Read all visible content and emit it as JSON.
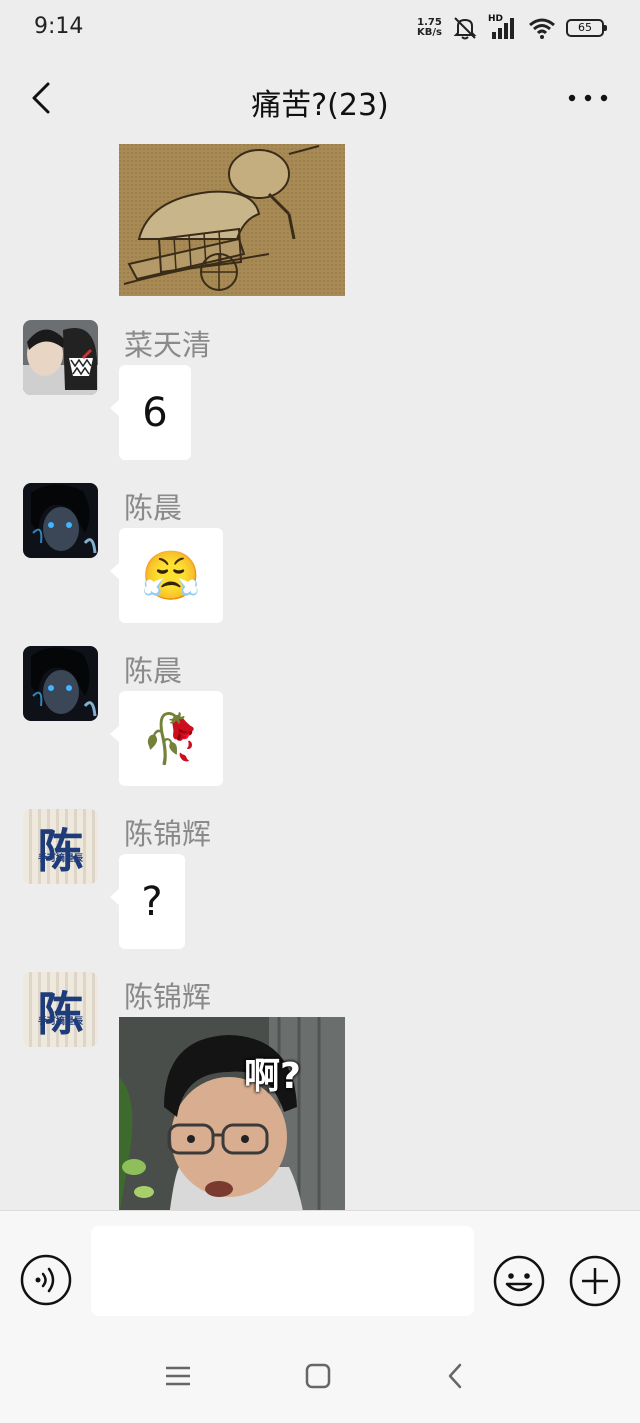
{
  "status_bar": {
    "time": "9:14",
    "net_speed_value": "1.75",
    "net_speed_unit": "KB/s",
    "signal_badge": "HD",
    "battery": "65"
  },
  "header": {
    "title": "痛苦?(23)"
  },
  "messages": [
    {
      "type": "image",
      "image": "ancient-painting-sedan-chair"
    },
    {
      "type": "text",
      "sender": "菜天清",
      "avatar": "boy-with-shark-hoodie",
      "text": "6"
    },
    {
      "type": "sticker",
      "sender": "陈晨",
      "avatar": "anime-dark-hair-blue-eyes",
      "emoji": "😤"
    },
    {
      "type": "sticker",
      "sender": "陈晨",
      "avatar": "anime-dark-hair-blue-eyes",
      "emoji": "🥀"
    },
    {
      "type": "text",
      "sender": "陈锦辉",
      "avatar": "chen-character-card",
      "text": "?"
    },
    {
      "type": "image",
      "sender": "陈锦辉",
      "avatar": "chen-character-card",
      "image": "man-with-glasses-meme",
      "overlay_text": "啊?"
    }
  ],
  "avatar_chen_card": {
    "big_char": "陈",
    "small_text": "手可摘星辰"
  },
  "input_bar": {
    "placeholder": ""
  },
  "colors": {
    "background": "#ededed",
    "bubble": "#ffffff",
    "name": "#8a8a8a"
  }
}
